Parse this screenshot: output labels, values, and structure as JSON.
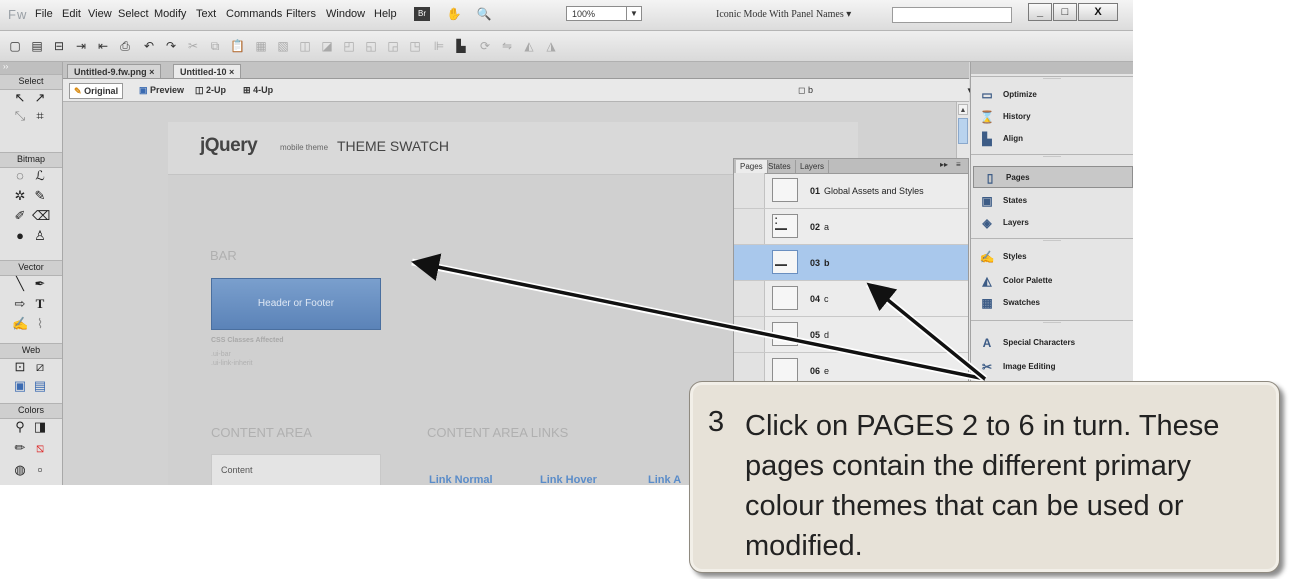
{
  "app": {
    "logo": "Fw",
    "menu": [
      "File",
      "Edit",
      "View",
      "Select",
      "Modify",
      "Text",
      "Commands",
      "Filters",
      "Window",
      "Help"
    ],
    "zoom": "100%",
    "workspace": "Iconic Mode With Panel Names",
    "window_buttons": [
      "_",
      "□",
      "X"
    ]
  },
  "tools": {
    "sections": [
      "Select",
      "Bitmap",
      "Vector",
      "Web",
      "Colors"
    ]
  },
  "document": {
    "tabs": [
      "Untitled-9.fw.png",
      "Untitled-10"
    ],
    "view_buttons": [
      "Original",
      "Preview",
      "2-Up",
      "4-Up"
    ],
    "page_selector": "b"
  },
  "canvas": {
    "logo": "jQuery",
    "logo_sub": "mobile theme",
    "title": "THEME SWATCH",
    "bar_heading": "BAR",
    "bar_button": "Header or Footer",
    "css_label": "CSS Classes Affected",
    "css_classes": [
      ".ui-bar",
      ".ui-link-inherit"
    ],
    "content_heading": "CONTENT AREA",
    "links_heading": "CONTENT AREA LINKS",
    "content_box": "Content",
    "links": [
      "Link Normal",
      "Link Hover",
      "Link A"
    ]
  },
  "pages_panel": {
    "tabs": [
      "Pages",
      "States",
      "Layers"
    ],
    "pages": [
      {
        "num": "01",
        "name": "Global Assets and Styles"
      },
      {
        "num": "02",
        "name": "a"
      },
      {
        "num": "03",
        "name": "b"
      },
      {
        "num": "04",
        "name": "c"
      },
      {
        "num": "05",
        "name": "d"
      },
      {
        "num": "06",
        "name": "e"
      }
    ],
    "selected": "03"
  },
  "right_panel": {
    "items": [
      "Optimize",
      "History",
      "Align",
      "Pages",
      "States",
      "Layers",
      "Styles",
      "Color Palette",
      "Swatches",
      "Special Characters",
      "Image Editing"
    ],
    "selected": "Pages"
  },
  "callout": {
    "number": "3",
    "text": "Click on PAGES 2 to 6 in turn. These pages contain the different primary colour themes that can be used or modified."
  },
  "colors": {
    "selection": "#a9c8ec",
    "bar_button": "#6a91c3",
    "link": "#5a8cc9",
    "callout_bg": "#e7e2d8"
  }
}
